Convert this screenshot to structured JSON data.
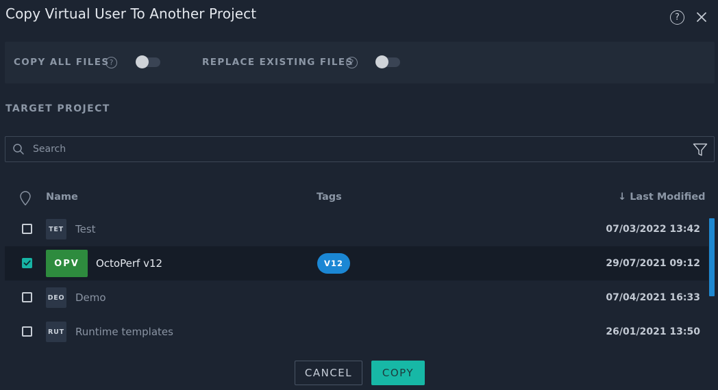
{
  "dialog": {
    "title": "Copy Virtual User To Another Project",
    "help_icon": "question-circle-icon",
    "close_icon": "close-icon"
  },
  "options": {
    "copy_all_files": {
      "label": "COPY ALL FILES",
      "enabled": false
    },
    "replace_existing_files": {
      "label": "REPLACE EXISTING FILES",
      "enabled": false
    }
  },
  "target": {
    "label": "TARGET PROJECT"
  },
  "search": {
    "placeholder": "Search",
    "value": ""
  },
  "table": {
    "columns": {
      "name": "Name",
      "tags": "Tags",
      "last_modified": "↓ Last Modified"
    },
    "rows": [
      {
        "initials": "TET",
        "name": "Test",
        "tag": "",
        "date": "07/03/2022 13:42",
        "checked": false
      },
      {
        "initials": "OPV",
        "name": "OctoPerf v12",
        "tag": "V12",
        "date": "29/07/2021 09:12",
        "checked": true
      },
      {
        "initials": "DEO",
        "name": "Demo",
        "tag": "",
        "date": "07/04/2021 16:33",
        "checked": false
      },
      {
        "initials": "RUT",
        "name": "Runtime templates",
        "tag": "",
        "date": "26/01/2021 13:50",
        "checked": false
      }
    ]
  },
  "footer": {
    "cancel_label": "CANCEL",
    "copy_label": "COPY"
  },
  "colors": {
    "background": "#1c2431",
    "panel": "#222b38",
    "accent": "#17b8a6",
    "selected_avatar": "#2e8b3e",
    "tag": "#1b87d4"
  }
}
